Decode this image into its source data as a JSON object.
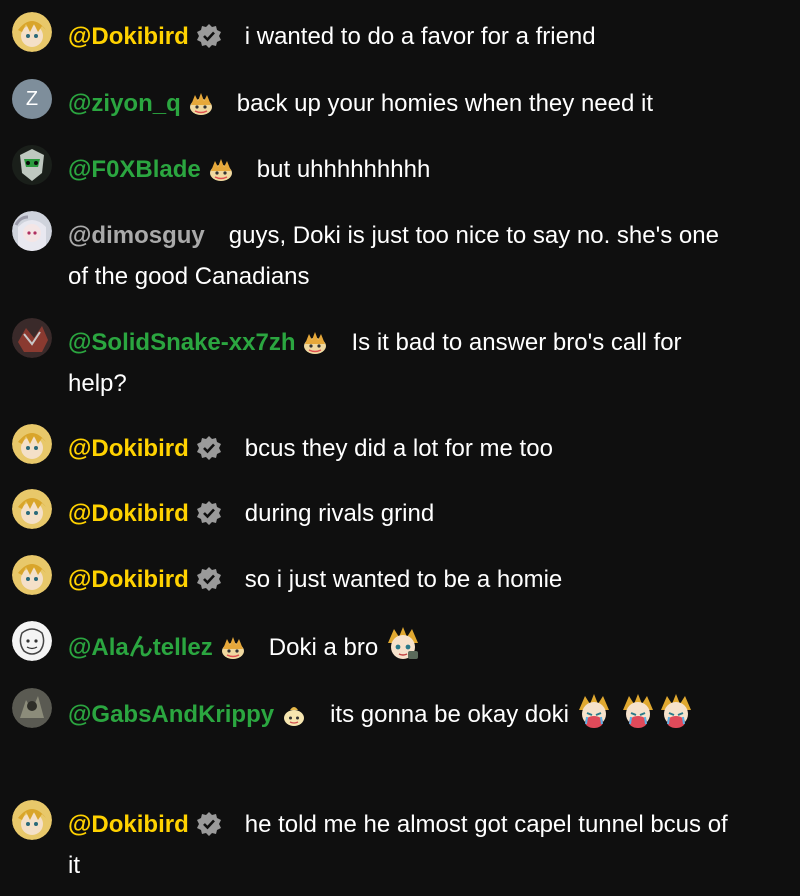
{
  "messages": [
    {
      "author": "@Dokibird",
      "role": "owner",
      "badge": "verified-icon",
      "text": "i wanted to do a favor for a friend",
      "emotes": []
    },
    {
      "author": "@ziyon_q",
      "role": "member",
      "badge": "member-badge-icon",
      "avatar_letter": "Z",
      "text": "back up your homies when they need it",
      "emotes": []
    },
    {
      "author": "@F0XBlade",
      "role": "member",
      "badge": "member-badge-icon",
      "text": "but uhhhhhhhhh",
      "emotes": []
    },
    {
      "author": "@dimosguy",
      "role": "plain",
      "badge": "",
      "text": "guys, Doki is just too nice to say no. she's one of the good Canadians",
      "emotes": []
    },
    {
      "author": "@SolidSnake-xx7zh",
      "role": "member",
      "badge": "member-badge-icon",
      "text": "Is it bad to answer bro's call for help?",
      "emotes": []
    },
    {
      "author": "@Dokibird",
      "role": "owner",
      "badge": "verified-icon",
      "text": "bcus they did a lot for me too",
      "emotes": []
    },
    {
      "author": "@Dokibird",
      "role": "owner",
      "badge": "verified-icon",
      "text": "during rivals grind",
      "emotes": []
    },
    {
      "author": "@Dokibird",
      "role": "owner",
      "badge": "verified-icon",
      "text": "so i just wanted to be a homie",
      "emotes": []
    },
    {
      "author": "@Alaんtellez",
      "role": "member",
      "badge": "member-badge-icon",
      "text": "Doki a bro",
      "emotes": [
        "doki-emote-icon"
      ]
    },
    {
      "author": "@GabsAndKrippy",
      "role": "member",
      "badge": "member-badge-icon",
      "text": "its gonna be okay doki",
      "emotes": [
        "doki-cry-emote-icon",
        "doki-cry-emote-icon",
        "doki-cry-emote-icon"
      ]
    },
    {
      "author": "@Dokibird",
      "role": "owner",
      "badge": "verified-icon",
      "text": "he told me he almost got capel tunnel bcus of it",
      "emotes": []
    }
  ],
  "colors": {
    "background": "#0f0f0f",
    "owner": "#ffd200",
    "member": "#2ba640",
    "plain": "#aaaaaa",
    "text": "#ffffff"
  }
}
